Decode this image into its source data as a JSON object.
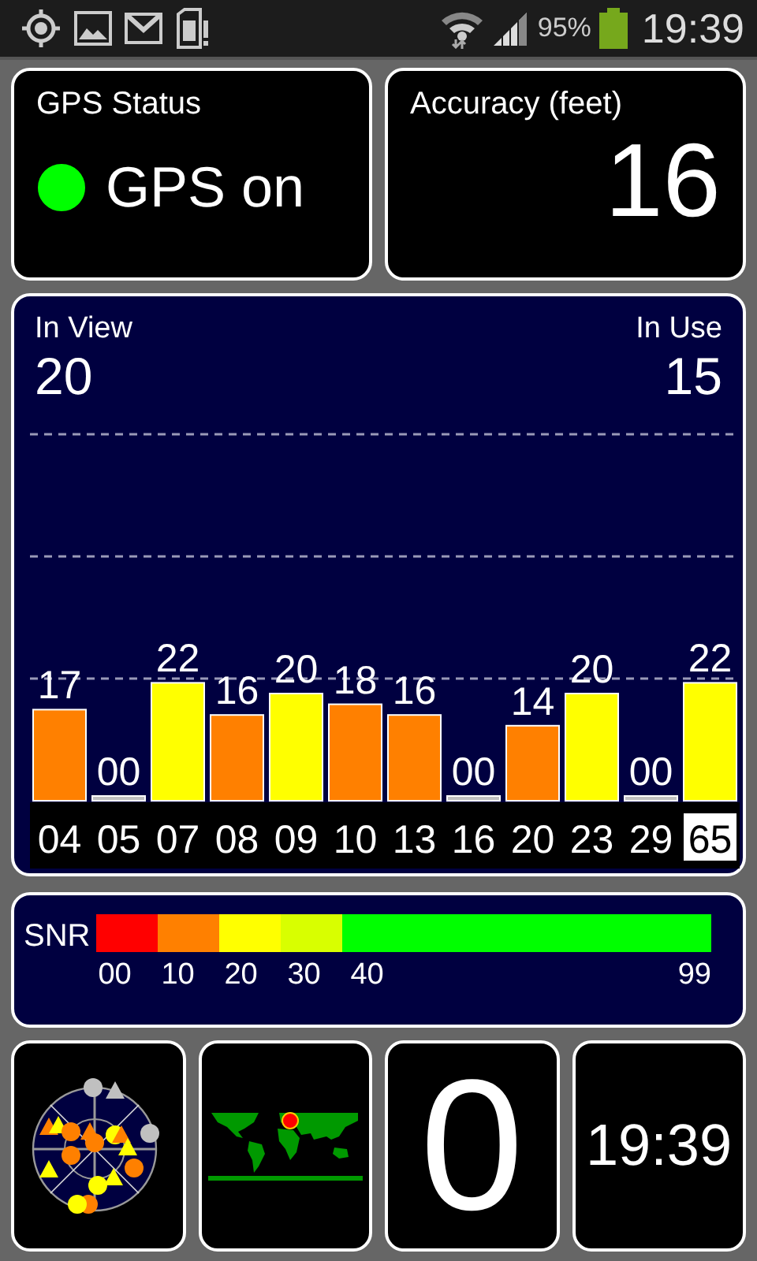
{
  "status_bar": {
    "battery": "95%",
    "time": "19:39"
  },
  "gps_status": {
    "title": "GPS Status",
    "label": "GPS on",
    "on": true
  },
  "accuracy": {
    "title": "Accuracy (feet)",
    "value": "16"
  },
  "satellites": {
    "in_view_label": "In View",
    "in_view": "20",
    "in_use_label": "In Use",
    "in_use": "15",
    "chart_data": {
      "type": "bar",
      "categories": [
        "04",
        "05",
        "07",
        "08",
        "09",
        "10",
        "13",
        "16",
        "20",
        "23",
        "29",
        "65"
      ],
      "values": [
        17,
        0,
        22,
        16,
        20,
        18,
        16,
        0,
        14,
        20,
        0,
        22
      ],
      "value_labels": [
        "17",
        "00",
        "22",
        "16",
        "20",
        "18",
        "16",
        "00",
        "14",
        "20",
        "00",
        "22"
      ],
      "data_labels": true
    },
    "highlighted": [
      false,
      false,
      false,
      false,
      false,
      false,
      false,
      false,
      false,
      false,
      false,
      true
    ]
  },
  "snr_scale": {
    "label": "SNR",
    "segments": [
      {
        "label": "00",
        "color": "#ff0000"
      },
      {
        "label": "10",
        "color": "#ff8000"
      },
      {
        "label": "20",
        "color": "#ffff00"
      },
      {
        "label": "30",
        "color": "#d8ff00"
      },
      {
        "label": "40",
        "color": "#00ff00"
      }
    ],
    "end_label": "99"
  },
  "tiles": {
    "count": "0",
    "time": "19:39"
  }
}
